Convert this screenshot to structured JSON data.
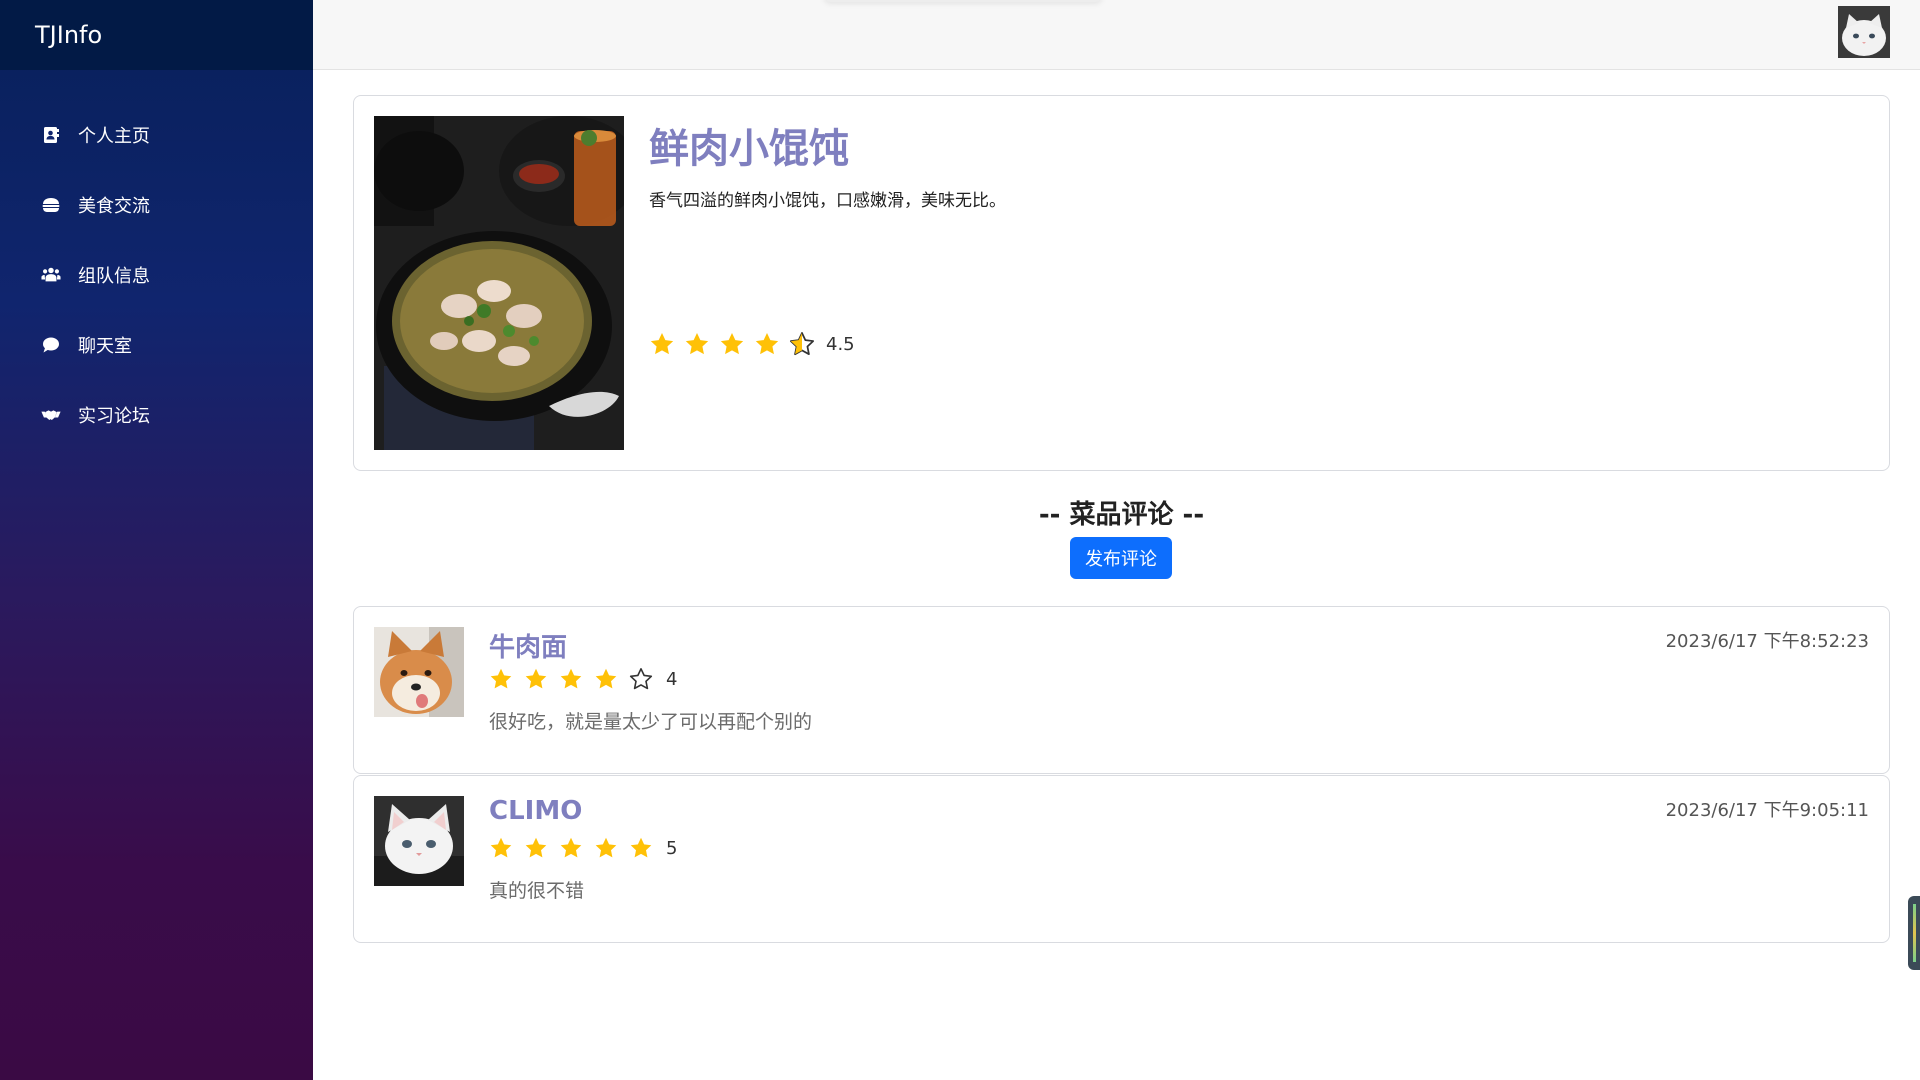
{
  "app": {
    "brand": "TJInfo"
  },
  "sidebar": {
    "items": [
      {
        "label": "个人主页",
        "icon": "contact-book-icon"
      },
      {
        "label": "美食交流",
        "icon": "burger-icon"
      },
      {
        "label": "组队信息",
        "icon": "users-group-icon"
      },
      {
        "label": "聊天室",
        "icon": "chat-bubble-icon"
      },
      {
        "label": "实习论坛",
        "icon": "handshake-icon"
      }
    ]
  },
  "dish": {
    "title": "鲜肉小馄饨",
    "description": "香气四溢的鲜肉小馄饨，口感嫩滑，美味无比。",
    "rating": 4.5,
    "rating_label": "4.5"
  },
  "reviews_section": {
    "title": "-- 菜品评论 --",
    "post_button": "发布评论"
  },
  "comments": [
    {
      "name": "牛肉面",
      "rating": 4,
      "rating_label": "4",
      "text": "很好吃，就是量太少了可以再配个别的",
      "time": "2023/6/17 下午8:52:23",
      "avatar": "shiba-dog-avatar"
    },
    {
      "name": "CLIMO",
      "rating": 5,
      "rating_label": "5",
      "text": "真的很不错",
      "time": "2023/6/17 下午9:05:11",
      "avatar": "white-cat-avatar"
    }
  ],
  "colors": {
    "accent_title": "#7f7fbf",
    "star": "#ffc107",
    "button": "#0d6efd",
    "sidebar_top": "#08205a",
    "sidebar_bottom": "#3a0a44"
  }
}
